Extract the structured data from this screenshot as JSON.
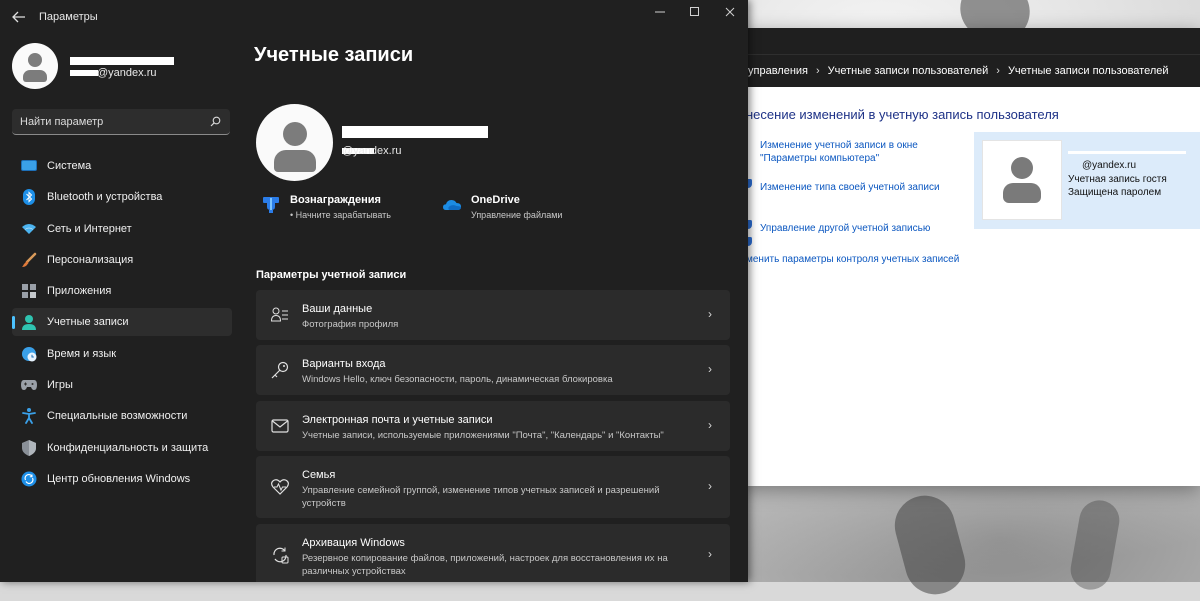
{
  "settings_window": {
    "app_title": "Параметры",
    "back_icon": "arrow-left-icon",
    "window_controls": [
      "minimize",
      "maximize",
      "close"
    ],
    "profile": {
      "email": "@yandex.ru"
    },
    "search": {
      "placeholder": "Найти параметр",
      "value": ""
    },
    "nav": [
      {
        "label": "Система",
        "icon": "monitor-icon",
        "active": false
      },
      {
        "label": "Bluetooth и устройства",
        "icon": "bluetooth-icon",
        "active": false
      },
      {
        "label": "Сеть и Интернет",
        "icon": "wifi-icon",
        "active": false
      },
      {
        "label": "Персонализация",
        "icon": "brush-icon",
        "active": false
      },
      {
        "label": "Приложения",
        "icon": "apps-icon",
        "active": false
      },
      {
        "label": "Учетные записи",
        "icon": "person-icon",
        "active": true
      },
      {
        "label": "Время и язык",
        "icon": "globe-clock-icon",
        "active": false
      },
      {
        "label": "Игры",
        "icon": "gamepad-icon",
        "active": false
      },
      {
        "label": "Специальные возможности",
        "icon": "accessibility-icon",
        "active": false
      },
      {
        "label": "Конфиденциальность и защита",
        "icon": "shield-icon",
        "active": false
      },
      {
        "label": "Центр обновления Windows",
        "icon": "update-icon",
        "active": false
      }
    ],
    "main": {
      "title": "Учетные записи",
      "account_email": "@yandex.ru",
      "services": [
        {
          "title": "Вознаграждения",
          "subtitle": "• Начните зарабатывать",
          "icon": "rewards-trophy-icon"
        },
        {
          "title": "OneDrive",
          "subtitle": "Управление файлами",
          "icon": "onedrive-cloud-icon"
        }
      ],
      "section_title": "Параметры учетной записи",
      "cards": [
        {
          "title": "Ваши данные",
          "subtitle": "Фотография профиля",
          "icon": "person-details-icon"
        },
        {
          "title": "Варианты входа",
          "subtitle": "Windows Hello, ключ безопасности, пароль, динамическая блокировка",
          "icon": "key-icon"
        },
        {
          "title": "Электронная почта и учетные записи",
          "subtitle": "Учетные записи, используемые приложениями \"Почта\", \"Календарь\" и \"Контакты\"",
          "icon": "mail-icon"
        },
        {
          "title": "Семья",
          "subtitle": "Управление семейной группой, изменение типов учетных записей и разрешений устройств",
          "icon": "family-heart-icon"
        },
        {
          "title": "Архивация Windows",
          "subtitle": "Резервное копирование файлов, приложений, настроек для восстановления их на различных устройствах",
          "icon": "backup-icon"
        }
      ]
    }
  },
  "control_panel": {
    "breadcrumb": [
      "управления",
      "Учетные записи пользователей",
      "Учетные записи пользователей"
    ],
    "heading": "несение изменений в учетную запись пользователя",
    "links": [
      "Изменение учетной записи в окне \"Параметры компьютера\"",
      "Изменение типа своей учетной записи",
      "Управление другой учетной записью",
      "менить параметры контроля учетных записей"
    ],
    "user_card": {
      "email": "@yandex.ru",
      "type": "Учетная запись гостя",
      "status": "Защищена паролем"
    }
  },
  "colors": {
    "accent": "#4cc2ff",
    "window_bg": "#202020",
    "card_bg": "#2b2b2b",
    "link": "#0b57c0"
  }
}
